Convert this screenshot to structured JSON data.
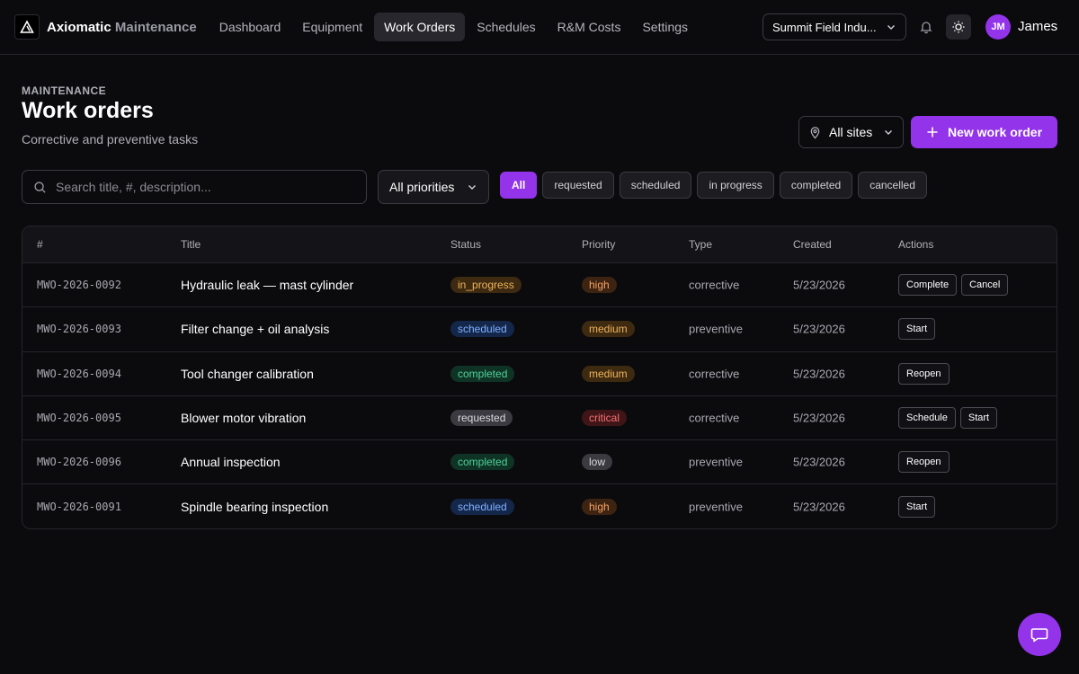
{
  "app": {
    "brand_main": "Axiomatic",
    "brand_sub": "Maintenance"
  },
  "nav": {
    "links": [
      "Dashboard",
      "Equipment",
      "Work Orders",
      "Schedules",
      "R&M Costs",
      "Settings"
    ],
    "active": "Work Orders"
  },
  "org_select": {
    "value": "Summit Field Indu..."
  },
  "user": {
    "initials": "JM",
    "name": "James"
  },
  "header": {
    "eyebrow": "MAINTENANCE",
    "title": "Work orders",
    "subtitle": "Corrective and preventive tasks",
    "sites_label": "All sites",
    "new_button": "New work order"
  },
  "filters": {
    "search_placeholder": "Search title, #, description...",
    "search_value": "",
    "priority_value": "All priorities",
    "status_chips": [
      "All",
      "requested",
      "scheduled",
      "in progress",
      "completed",
      "cancelled"
    ],
    "active_chip": "All"
  },
  "table": {
    "columns": [
      "#",
      "Title",
      "Status",
      "Priority",
      "Type",
      "Created",
      "Actions"
    ],
    "rows": [
      {
        "id": "MWO-2026-0092",
        "title": "Hydraulic leak — mast cylinder",
        "status": "in_progress",
        "priority": "high",
        "type": "corrective",
        "created": "5/23/2026",
        "actions": [
          "Complete",
          "Cancel"
        ]
      },
      {
        "id": "MWO-2026-0093",
        "title": "Filter change + oil analysis",
        "status": "scheduled",
        "priority": "medium",
        "type": "preventive",
        "created": "5/23/2026",
        "actions": [
          "Start"
        ]
      },
      {
        "id": "MWO-2026-0094",
        "title": "Tool changer calibration",
        "status": "completed",
        "priority": "medium",
        "type": "corrective",
        "created": "5/23/2026",
        "actions": [
          "Reopen"
        ]
      },
      {
        "id": "MWO-2026-0095",
        "title": "Blower motor vibration",
        "status": "requested",
        "priority": "critical",
        "type": "corrective",
        "created": "5/23/2026",
        "actions": [
          "Schedule",
          "Start"
        ]
      },
      {
        "id": "MWO-2026-0096",
        "title": "Annual inspection",
        "status": "completed",
        "priority": "low",
        "type": "preventive",
        "created": "5/23/2026",
        "actions": [
          "Reopen"
        ]
      },
      {
        "id": "MWO-2026-0091",
        "title": "Spindle bearing inspection",
        "status": "scheduled",
        "priority": "high",
        "type": "preventive",
        "created": "5/23/2026",
        "actions": [
          "Start"
        ]
      }
    ]
  },
  "colors": {
    "accent": "#9333ea",
    "status": {
      "in_progress": {
        "bg": "#3d2a10",
        "fg": "#f0b35a"
      },
      "scheduled": {
        "bg": "#14274a",
        "fg": "#7fb0ff"
      },
      "completed": {
        "bg": "#0f3324",
        "fg": "#4fd39a"
      },
      "requested": {
        "bg": "#3a3a40",
        "fg": "#d8d8de"
      }
    },
    "priority": {
      "high": {
        "bg": "#3d2312",
        "fg": "#f5a262"
      },
      "medium": {
        "bg": "#3d2a10",
        "fg": "#f0b35a"
      },
      "critical": {
        "bg": "#3f1518",
        "fg": "#f87171"
      },
      "low": {
        "bg": "#3a3a40",
        "fg": "#d8d8de"
      }
    }
  },
  "icons": {
    "logo": "triangle-logo-icon",
    "bell": "bell-icon",
    "theme": "sun-icon",
    "pin": "map-pin-icon",
    "search": "search-icon",
    "chat": "chat-icon"
  }
}
